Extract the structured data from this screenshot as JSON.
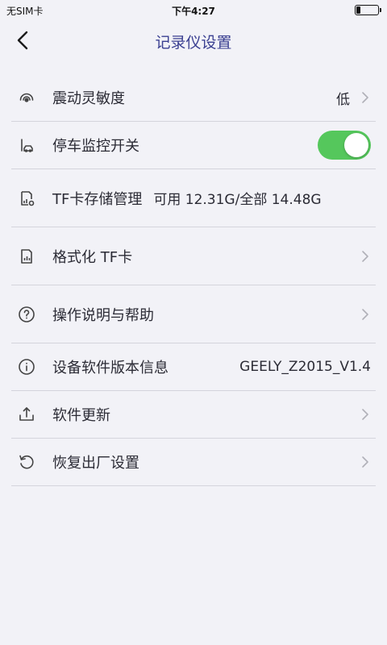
{
  "status_bar": {
    "carrier": "无SIM卡",
    "time": "下午4:27"
  },
  "nav": {
    "title": "记录仪设置"
  },
  "settings": {
    "vibration": {
      "label": "震动灵敏度",
      "value": "低",
      "icon": "vibration-icon"
    },
    "parking": {
      "label": "停车监控开关",
      "toggle_on": true,
      "icon": "parking-icon"
    },
    "tf_storage": {
      "label": "TF卡存储管理",
      "value": "可用 12.31G/全部 14.48G",
      "icon": "sd-card-storage-icon"
    },
    "format_tf": {
      "label": "格式化 TF卡",
      "icon": "sd-card-icon"
    },
    "help": {
      "label": "操作说明与帮助",
      "icon": "question-circle-icon"
    },
    "version": {
      "label": "设备软件版本信息",
      "value": "GEELY_Z2015_V1.4",
      "icon": "info-circle-icon"
    },
    "update": {
      "label": "软件更新",
      "icon": "upload-icon"
    },
    "reset": {
      "label": "恢复出厂设置",
      "icon": "reset-icon"
    }
  },
  "colors": {
    "accent_title": "#3a3f91",
    "toggle_on": "#55c75c",
    "background": "#f2f2f7"
  }
}
